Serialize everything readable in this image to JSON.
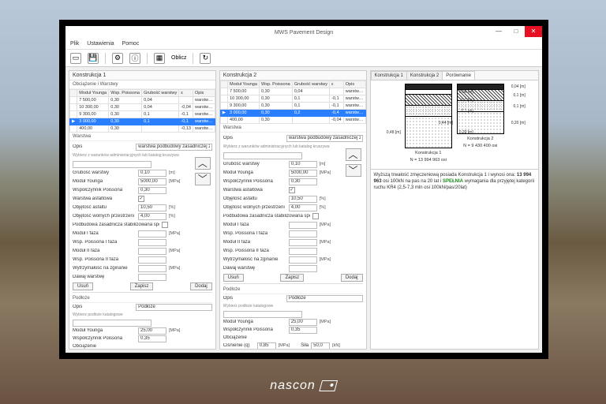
{
  "window_title": "MWS Pavement Design",
  "winbtns": {
    "min": "—",
    "max": "□",
    "close": "✕"
  },
  "menu": [
    "Plik",
    "Ustawienia",
    "Pomoc"
  ],
  "toolbar_oblicz": "Oblicz",
  "col_labels": {
    "k1": "Konstrukcja 1",
    "k2": "Konstrukcja 2"
  },
  "subheads": {
    "obc": "Obciążenie i Warstwy",
    "war": "Warstwa",
    "pod": "Podłoże"
  },
  "table": {
    "headers": [
      "",
      "Moduł Younga",
      "Wsp. Poissona",
      "Grubość warstwy",
      "ε",
      "Opis"
    ],
    "rows1": [
      [
        "",
        "7 500,00",
        "0,30",
        "0,04",
        "",
        "warstw…"
      ],
      [
        "",
        "10 300,00",
        "0,30",
        "0,04",
        "-0,04",
        "warstw…"
      ],
      [
        "",
        "9 300,00",
        "0,30",
        "0,1",
        "-0,1",
        "warstw…"
      ],
      [
        "▶",
        "3 000,00",
        "0,30",
        "0,1",
        "-0,1",
        "warstw…"
      ],
      [
        "",
        "400,00",
        "0,30",
        "",
        "  -0,13",
        "warstw…"
      ]
    ],
    "rows2": [
      [
        "",
        "7 500,00",
        "0,30",
        "0,04",
        "",
        "warstw…"
      ],
      [
        "",
        "10 300,00",
        "0,30",
        "0,1",
        "-0,1",
        "warstw…"
      ],
      [
        "",
        "9 300,00",
        "0,30",
        "0,1",
        "-0,1",
        "warstw…"
      ],
      [
        "▶",
        "3 000,00",
        "0,30",
        "0,2",
        "-0,4",
        "warstw…"
      ],
      [
        "",
        "400,00",
        "0,30",
        "",
        "  -0,04",
        "warstw…"
      ]
    ]
  },
  "form": {
    "opis_label": "Opis",
    "opis_value": "warstwa podbudowy zasadniczej z betonu asf",
    "catalog_label": "Wybierz z warunków administracyjnych lub katalog kruszywa",
    "grubosc": "Grubość warstwy",
    "grubosc_v": "0,10",
    "grubosc_u": "[m]",
    "modul": "Moduł Younga",
    "modul_v": "5000,00",
    "modul_u": "[MPa]",
    "wsp": "Współczynnik Poissona",
    "wsp_v": "0,30",
    "asfalt": "Warstwa asfaltowa",
    "objasf": "Objętość asfaltu",
    "objasf_v": "10,50",
    "objasf_u": "[%]",
    "objwol": "Objętość wolnych przestrzeni",
    "objwol_v": "4,00",
    "objwol_u": "[%]",
    "stab": "Podbudowa zasadnicza stabilizowana spoiwem hydr.",
    "mf1": "Moduł I faza",
    "mf1_u": "[MPa]",
    "wpf1": "Wsp. Poissona I faza",
    "mf2": "Moduł II faza",
    "mf2_u": "[MPa]",
    "wpf2": "Wsp. Poissona II faza",
    "wytrz": "Wytrzymałość na zginanie",
    "wytrz_u": "[MPa]",
    "dawaj": "Dawaj warstwę",
    "btn_usun": "Usuń",
    "btn_zapisz": "Zapisz",
    "btn_dodaj": "Dodaj"
  },
  "podloze": {
    "opis": "Opis",
    "opis_v": "Podłoże",
    "catalog": "Wybierz podłoże katalogowe",
    "modul": "Moduł Younga",
    "modul_v": "25,00",
    "modul_u": "[MPa]",
    "wsp": "Współczynnik Poissona",
    "wsp_v": "0,35",
    "obc": "Obciążenie",
    "cisn": "Ciśnienie (q)",
    "cisn_v": "0,85",
    "cisn_u": "[MPa]",
    "sila": "Siła",
    "sila_v": "50,0",
    "sila_u": "[kN]",
    "sila_v2": "50,0"
  },
  "tabs": [
    "Konstrukcja 1",
    "Konstrukcja 2",
    "Porównanie"
  ],
  "diag": {
    "k1": {
      "caption": "Konstrukcja 1",
      "N": "N = 13 994 963 osi",
      "layers": [
        {
          "h": 6,
          "cls": "dark",
          "r": "0,04 [m]"
        },
        {
          "h": 6,
          "cls": "",
          "r": "0,04 [m]"
        },
        {
          "h": 14,
          "cls": "hatched",
          "r": "0,1 [m]"
        },
        {
          "h": 14,
          "cls": "dotted2",
          "r": "0,1 [m]"
        },
        {
          "h": 40,
          "cls": "dotted",
          "r": "0,20 [m]",
          "l": "0,48 [m]"
        }
      ]
    },
    "k2": {
      "caption": "Konstrukcja 2",
      "N": "N = 9 430 400 osi",
      "layers": [
        {
          "h": 6,
          "cls": "dark",
          "r": "0,04 [m]"
        },
        {
          "h": 14,
          "cls": "hatched",
          "r": "0,1 [m]"
        },
        {
          "h": 14,
          "cls": "dotted2",
          "r": "0,1 [m]"
        },
        {
          "h": 28,
          "cls": "dotted",
          "r": "0,20 [m]",
          "l": "0,44 [m]"
        }
      ]
    }
  },
  "summary": {
    "p1": "Wyższą trwałość zmęczeniową posiada Konstrukcja 1 i wynosi ona:",
    "n": "13 994 963",
    "p2": " osi 100kN na pas na 20 lat i ",
    "verdict": "SPEŁNIA",
    "p3": " wymagania dla przyjętej kategorii ruchu KR4 (2,5-7,3 mln osi 100kN/pas/20lat)"
  },
  "logo": "nascon"
}
